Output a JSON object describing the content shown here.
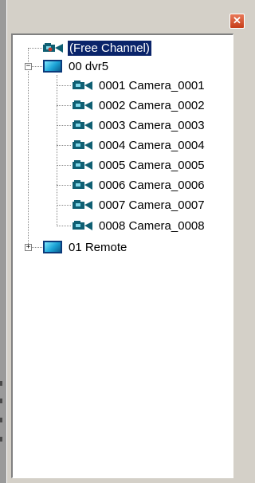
{
  "window": {
    "close_glyph": "✕"
  },
  "tree": {
    "free_channel": {
      "label": "(Free Channel)",
      "selected": true,
      "icon": "camera-icon"
    },
    "groups": [
      {
        "label": "00 dvr5",
        "expanded": true,
        "expander": "−",
        "icon": "dvr-icon",
        "cameras": [
          "0001 Camera_0001",
          "0002 Camera_0002",
          "0003 Camera_0003",
          "0004 Camera_0004",
          "0005 Camera_0005",
          "0006 Camera_0006",
          "0007 Camera_0007",
          "0008 Camera_0008"
        ]
      },
      {
        "label": "01 Remote",
        "expanded": false,
        "expander": "+",
        "icon": "dvr-icon"
      }
    ]
  },
  "colors": {
    "selection": "#0a246a",
    "camera": "#0f5f73",
    "panel": "#d4d0c8"
  }
}
